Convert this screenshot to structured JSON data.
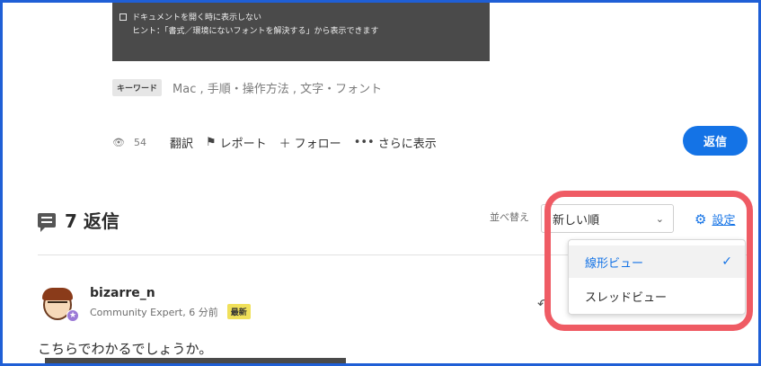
{
  "prior_post": {
    "screenshot_panel": {
      "checkbox_label": "ドキュメントを開く時に表示しない",
      "hint_text": "ヒント：「書式／環境にないフォントを解決する」から表示できます"
    },
    "keywords": {
      "badge": "キーワード",
      "text": "Mac , 手順・操作方法 , 文字・フォント"
    },
    "actions": {
      "views": "54",
      "translate": "翻訳",
      "report": "レポート",
      "follow": "フォロー",
      "more": "さらに表示",
      "reply": "返信"
    }
  },
  "replies": {
    "count_label": "7 返信",
    "sort_label": "並べ替え",
    "sort_value": "新しい順",
    "settings_label": "設定",
    "view_menu": {
      "items": [
        {
          "label": "線形ビュー",
          "selected": true
        },
        {
          "label": "スレッドビュー",
          "selected": false
        }
      ]
    }
  },
  "reply_post": {
    "username": "bizarre_n",
    "role_time": "Community Expert, 6 分前",
    "badge": "最新",
    "body": "こちらでわかるでしょうか。"
  },
  "colors": {
    "accent": "#1473e6",
    "highlight": "#ef5b64",
    "frame": "#1f5fd6"
  },
  "icons": [
    "eye-icon",
    "flag-icon",
    "plus-icon",
    "more-icon",
    "comment-icon",
    "gear-icon",
    "chevron-down-icon",
    "check-icon",
    "reply-icon",
    "star-icon"
  ]
}
